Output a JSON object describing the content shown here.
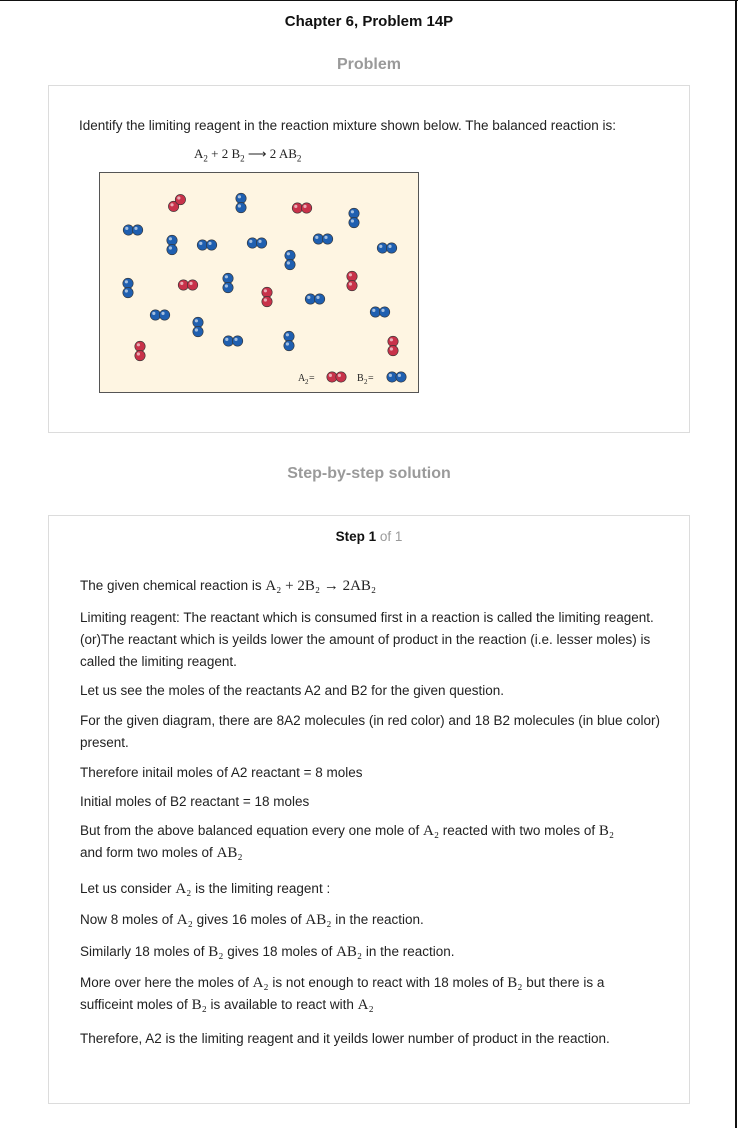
{
  "title": "Chapter 6, Problem 14P",
  "problem_heading": "Problem",
  "problem_text": "Identify the limiting reagent in the reaction mixture shown below. The balanced reaction is:",
  "equation": {
    "a2": "A",
    "plus_coef": " + 2 B",
    "arrow": " ⟶ 2 AB",
    "sub": "2"
  },
  "diagram": {
    "a2_color": "#c8324a",
    "b2_color": "#1f5fb0",
    "legend_a2": "A",
    "legend_b2": "B",
    "legend_sub": "2",
    "legend_eq": " ="
  },
  "solution_heading": "Step-by-step solution",
  "step": {
    "label": "Step 1",
    "of": " of 1"
  },
  "lines": {
    "l1_a": "The given chemical reaction is ",
    "l1_math": "A₂ + 2B₂ → 2AB₂",
    "l2": "Limiting reagent: The reactant which is consumed first in a reaction is called the limiting reagent. (or)The reactant which is yeilds lower the amount of product in the reaction (i.e. lesser moles) is called the limiting reagent.",
    "l3": "Let us see the moles of the reactants A2 and B2 for the given question.",
    "l4": "For the given diagram, there are 8A2 molecules (in red color) and 18 B2 molecules (in blue color) present.",
    "l5": "Therefore initail moles of A2 reactant = 8 moles",
    "l6": "Initial moles of B2 reactant = 18 moles",
    "l7_a": "But from the above balanced equation every one mole of ",
    "l7_m1": "A₂",
    "l7_b": " reacted with two moles of ",
    "l7_m2": "B₂",
    "l7_c": "and form two moles of ",
    "l7_m3": "AB₂",
    "l8_a": "Let us consider ",
    "l8_m": "A₂",
    "l8_b": " is the limiting reagent :",
    "l9_a": "Now 8 moles of ",
    "l9_m1": "A₂",
    "l9_b": " gives 16 moles of ",
    "l9_m2": "AB₂",
    "l9_c": " in the reaction.",
    "l10_a": "Similarly 18 moles of ",
    "l10_m1": "B₂",
    "l10_b": " gives 18 moles of ",
    "l10_m2": "AB₂",
    "l10_c": " in the reaction.",
    "l11_a": "More over here the moles of ",
    "l11_m1": "A₂",
    "l11_b": " is not enough to react with 18 moles of ",
    "l11_m2": "B₂",
    "l11_c": " but there is a",
    "l11_d": "sufficeint moles of ",
    "l11_m3": "B₂",
    "l11_e": " is available to react with ",
    "l11_m4": "A₂",
    "l12": "Therefore, A2 is the limiting reagent and it yeilds lower number of product in the reaction."
  }
}
